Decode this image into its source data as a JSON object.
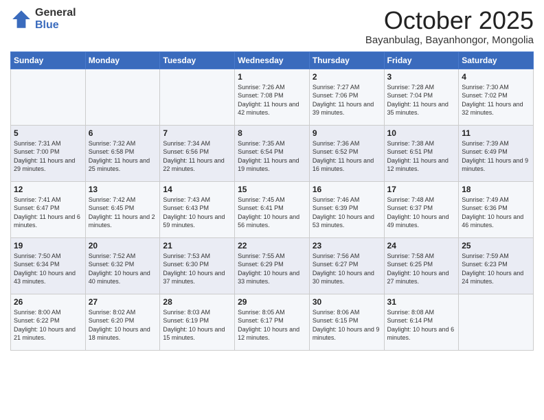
{
  "logo": {
    "general": "General",
    "blue": "Blue"
  },
  "title": "October 2025",
  "location": "Bayanbulag, Bayanhongor, Mongolia",
  "days_of_week": [
    "Sunday",
    "Monday",
    "Tuesday",
    "Wednesday",
    "Thursday",
    "Friday",
    "Saturday"
  ],
  "weeks": [
    [
      {
        "day": "",
        "info": ""
      },
      {
        "day": "",
        "info": ""
      },
      {
        "day": "",
        "info": ""
      },
      {
        "day": "1",
        "info": "Sunrise: 7:26 AM\nSunset: 7:08 PM\nDaylight: 11 hours\nand 42 minutes."
      },
      {
        "day": "2",
        "info": "Sunrise: 7:27 AM\nSunset: 7:06 PM\nDaylight: 11 hours\nand 39 minutes."
      },
      {
        "day": "3",
        "info": "Sunrise: 7:28 AM\nSunset: 7:04 PM\nDaylight: 11 hours\nand 35 minutes."
      },
      {
        "day": "4",
        "info": "Sunrise: 7:30 AM\nSunset: 7:02 PM\nDaylight: 11 hours\nand 32 minutes."
      }
    ],
    [
      {
        "day": "5",
        "info": "Sunrise: 7:31 AM\nSunset: 7:00 PM\nDaylight: 11 hours\nand 29 minutes."
      },
      {
        "day": "6",
        "info": "Sunrise: 7:32 AM\nSunset: 6:58 PM\nDaylight: 11 hours\nand 25 minutes."
      },
      {
        "day": "7",
        "info": "Sunrise: 7:34 AM\nSunset: 6:56 PM\nDaylight: 11 hours\nand 22 minutes."
      },
      {
        "day": "8",
        "info": "Sunrise: 7:35 AM\nSunset: 6:54 PM\nDaylight: 11 hours\nand 19 minutes."
      },
      {
        "day": "9",
        "info": "Sunrise: 7:36 AM\nSunset: 6:52 PM\nDaylight: 11 hours\nand 16 minutes."
      },
      {
        "day": "10",
        "info": "Sunrise: 7:38 AM\nSunset: 6:51 PM\nDaylight: 11 hours\nand 12 minutes."
      },
      {
        "day": "11",
        "info": "Sunrise: 7:39 AM\nSunset: 6:49 PM\nDaylight: 11 hours\nand 9 minutes."
      }
    ],
    [
      {
        "day": "12",
        "info": "Sunrise: 7:41 AM\nSunset: 6:47 PM\nDaylight: 11 hours\nand 6 minutes."
      },
      {
        "day": "13",
        "info": "Sunrise: 7:42 AM\nSunset: 6:45 PM\nDaylight: 11 hours\nand 2 minutes."
      },
      {
        "day": "14",
        "info": "Sunrise: 7:43 AM\nSunset: 6:43 PM\nDaylight: 10 hours\nand 59 minutes."
      },
      {
        "day": "15",
        "info": "Sunrise: 7:45 AM\nSunset: 6:41 PM\nDaylight: 10 hours\nand 56 minutes."
      },
      {
        "day": "16",
        "info": "Sunrise: 7:46 AM\nSunset: 6:39 PM\nDaylight: 10 hours\nand 53 minutes."
      },
      {
        "day": "17",
        "info": "Sunrise: 7:48 AM\nSunset: 6:37 PM\nDaylight: 10 hours\nand 49 minutes."
      },
      {
        "day": "18",
        "info": "Sunrise: 7:49 AM\nSunset: 6:36 PM\nDaylight: 10 hours\nand 46 minutes."
      }
    ],
    [
      {
        "day": "19",
        "info": "Sunrise: 7:50 AM\nSunset: 6:34 PM\nDaylight: 10 hours\nand 43 minutes."
      },
      {
        "day": "20",
        "info": "Sunrise: 7:52 AM\nSunset: 6:32 PM\nDaylight: 10 hours\nand 40 minutes."
      },
      {
        "day": "21",
        "info": "Sunrise: 7:53 AM\nSunset: 6:30 PM\nDaylight: 10 hours\nand 37 minutes."
      },
      {
        "day": "22",
        "info": "Sunrise: 7:55 AM\nSunset: 6:29 PM\nDaylight: 10 hours\nand 33 minutes."
      },
      {
        "day": "23",
        "info": "Sunrise: 7:56 AM\nSunset: 6:27 PM\nDaylight: 10 hours\nand 30 minutes."
      },
      {
        "day": "24",
        "info": "Sunrise: 7:58 AM\nSunset: 6:25 PM\nDaylight: 10 hours\nand 27 minutes."
      },
      {
        "day": "25",
        "info": "Sunrise: 7:59 AM\nSunset: 6:23 PM\nDaylight: 10 hours\nand 24 minutes."
      }
    ],
    [
      {
        "day": "26",
        "info": "Sunrise: 8:00 AM\nSunset: 6:22 PM\nDaylight: 10 hours\nand 21 minutes."
      },
      {
        "day": "27",
        "info": "Sunrise: 8:02 AM\nSunset: 6:20 PM\nDaylight: 10 hours\nand 18 minutes."
      },
      {
        "day": "28",
        "info": "Sunrise: 8:03 AM\nSunset: 6:19 PM\nDaylight: 10 hours\nand 15 minutes."
      },
      {
        "day": "29",
        "info": "Sunrise: 8:05 AM\nSunset: 6:17 PM\nDaylight: 10 hours\nand 12 minutes."
      },
      {
        "day": "30",
        "info": "Sunrise: 8:06 AM\nSunset: 6:15 PM\nDaylight: 10 hours\nand 9 minutes."
      },
      {
        "day": "31",
        "info": "Sunrise: 8:08 AM\nSunset: 6:14 PM\nDaylight: 10 hours\nand 6 minutes."
      },
      {
        "day": "",
        "info": ""
      }
    ]
  ]
}
